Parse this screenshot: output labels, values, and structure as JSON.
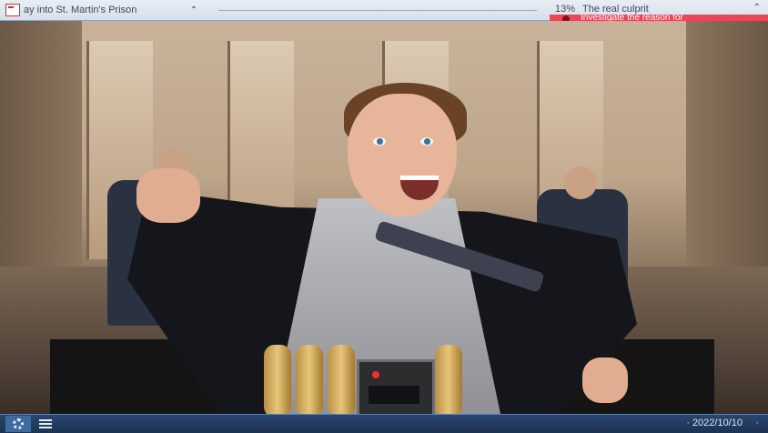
{
  "top_bar": {
    "quest_title": "ay into St. Martin's Prison",
    "progress_percent": "13%",
    "task_title": "The real culprit",
    "task_subtitle": "Investigate the reason for",
    "accent_color": "#e9465a"
  },
  "bottom_bar": {
    "date": "2022/10/10",
    "buttons": [
      {
        "icon": "gear-icon"
      },
      {
        "icon": "list-icon"
      }
    ]
  }
}
